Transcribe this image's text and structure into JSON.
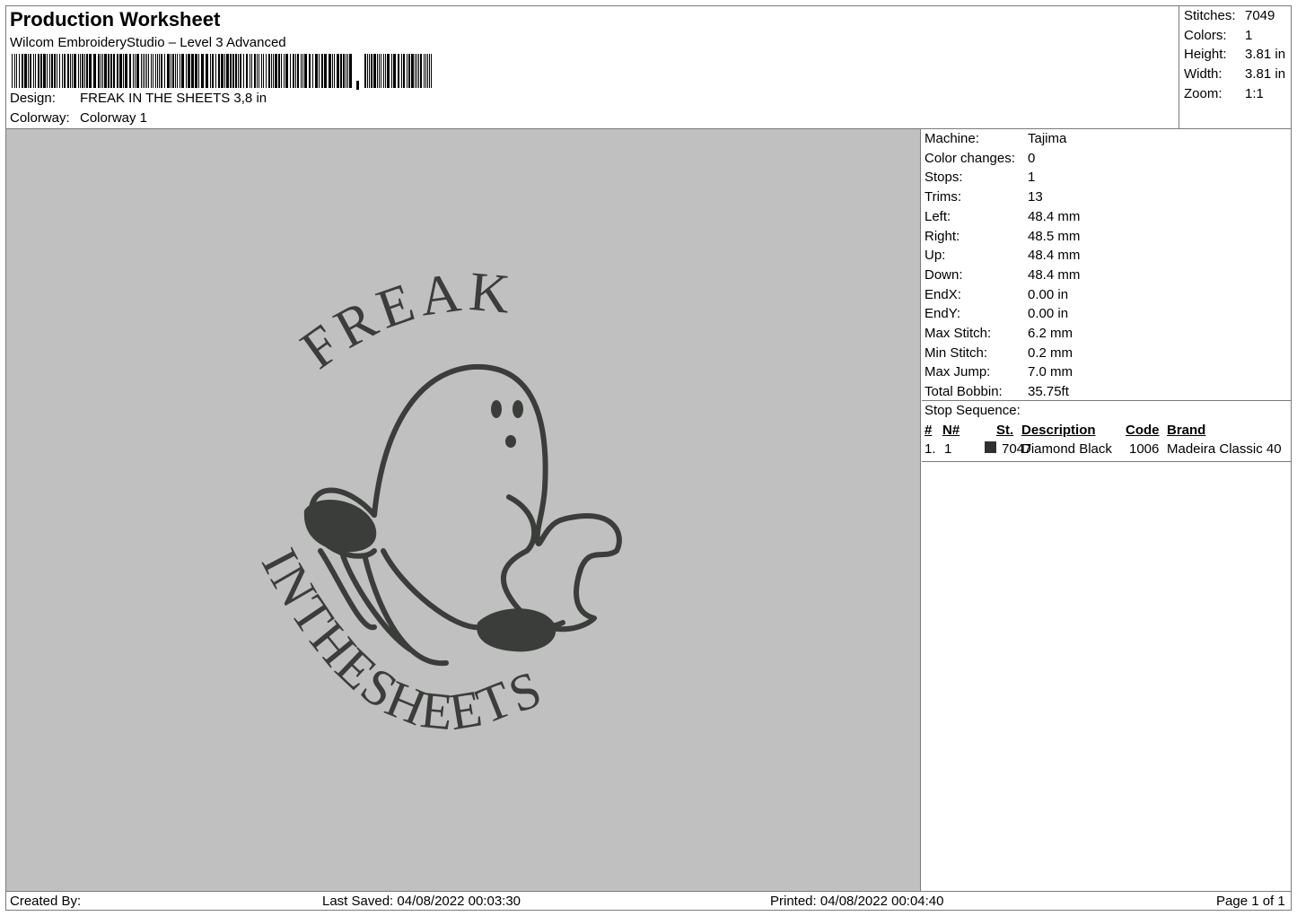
{
  "header": {
    "title": "Production Worksheet",
    "subtitle": "Wilcom EmbroideryStudio – Level 3 Advanced",
    "design_label": "Design:",
    "design_value": "FREAK IN THE SHEETS 3,8 in",
    "colorway_label": "Colorway:",
    "colorway_value": "Colorway 1"
  },
  "summary": [
    {
      "label": "Stitches:",
      "value": "7049"
    },
    {
      "label": "Colors:",
      "value": "1"
    },
    {
      "label": "Height:",
      "value": "3.81 in"
    },
    {
      "label": "Width:",
      "value": "3.81 in"
    },
    {
      "label": "Zoom:",
      "value": "1:1"
    }
  ],
  "info": [
    {
      "label": "Machine:",
      "value": "Tajima"
    },
    {
      "label": "Color changes:",
      "value": "0"
    },
    {
      "label": "Stops:",
      "value": "1"
    },
    {
      "label": "Trims:",
      "value": "13"
    },
    {
      "label": "Left:",
      "value": "48.4 mm"
    },
    {
      "label": "Right:",
      "value": "48.5 mm"
    },
    {
      "label": "Up:",
      "value": "48.4 mm"
    },
    {
      "label": "Down:",
      "value": "48.4 mm"
    },
    {
      "label": "EndX:",
      "value": "0.00 in"
    },
    {
      "label": "EndY:",
      "value": "0.00 in"
    },
    {
      "label": "Max Stitch:",
      "value": "6.2 mm"
    },
    {
      "label": "Min Stitch:",
      "value": "0.2 mm"
    },
    {
      "label": "Max Jump:",
      "value": "7.0 mm"
    },
    {
      "label": "Total Bobbin:",
      "value": "35.75ft"
    }
  ],
  "stop_sequence": {
    "title": "Stop Sequence:",
    "headers": {
      "num": "#",
      "needle": "N#",
      "st": "St.",
      "description": "Description",
      "code": "Code",
      "brand": "Brand"
    },
    "rows": [
      {
        "num": "1.",
        "needle": "1",
        "swatch_color": "#303030",
        "st": "7047",
        "description": "Diamond Black",
        "code": "1006",
        "brand": "Madeira Classic 40"
      }
    ]
  },
  "design_art": {
    "top_text": "FREAK",
    "bottom_text": "INTHESHEETS",
    "thread_color": "#3a3d3a",
    "background_color": "#c0c0c0"
  },
  "footer": {
    "created_by": "Created By:",
    "last_saved": "Last Saved: 04/08/2022 00:03:30",
    "printed": "Printed: 04/08/2022 00:04:40",
    "page": "Page 1 of 1"
  }
}
